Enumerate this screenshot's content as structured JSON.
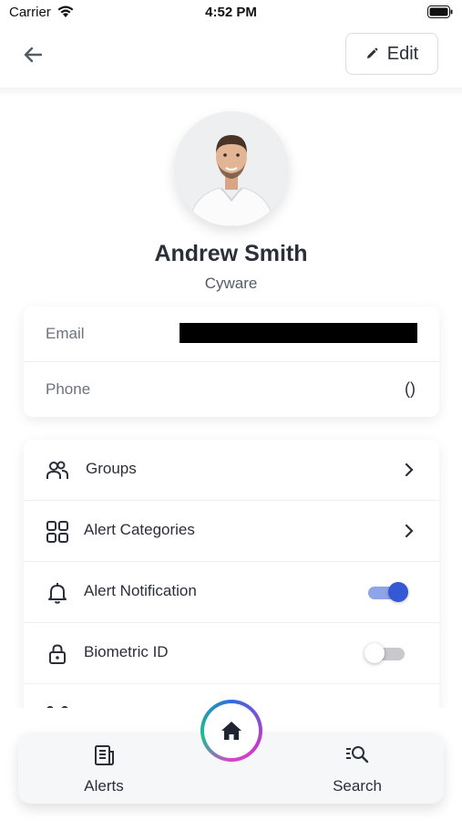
{
  "status_bar": {
    "carrier": "Carrier",
    "time": "4:52 PM"
  },
  "header": {
    "edit_label": "Edit"
  },
  "profile": {
    "name": "Andrew Smith",
    "organization": "Cyware"
  },
  "contact": {
    "email_label": "Email",
    "phone_label": "Phone",
    "phone_value": "()"
  },
  "menu": {
    "items": [
      {
        "label": "Groups",
        "icon": "users-icon",
        "control": "chevron"
      },
      {
        "label": "Alert Categories",
        "icon": "grid-icon",
        "control": "chevron"
      },
      {
        "label": "Alert Notification",
        "icon": "bell-icon",
        "control": "toggle",
        "toggle_on": true
      },
      {
        "label": "Biometric ID",
        "icon": "lock-icon",
        "control": "toggle",
        "toggle_on": false
      }
    ]
  },
  "tabbar": {
    "alerts_label": "Alerts",
    "search_label": "Search"
  },
  "colors": {
    "accent": "#3458d6",
    "text": "#2a2f3a",
    "muted": "#6b717d"
  }
}
